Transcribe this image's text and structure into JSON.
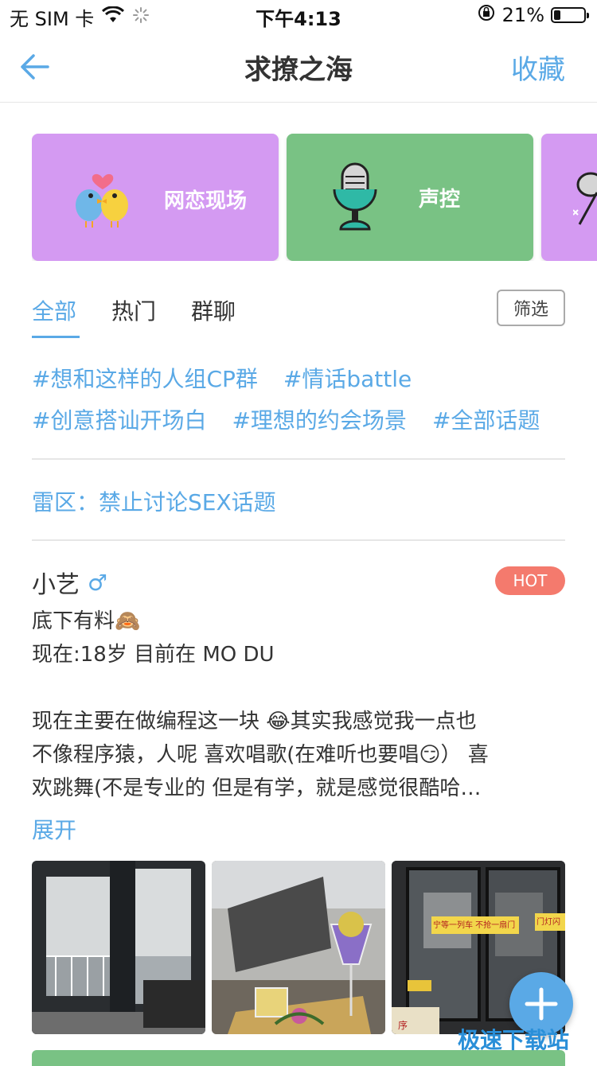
{
  "status_bar": {
    "carrier": "无 SIM 卡",
    "time": "下午4:13",
    "battery": "21%",
    "battery_level": 0.21
  },
  "nav": {
    "title": "求撩之海",
    "favorite_label": "收藏"
  },
  "categories": [
    {
      "label": "网恋现场",
      "color": "#d49af2",
      "icon": "lovebirds-icon"
    },
    {
      "label": "声控",
      "color": "#79c284",
      "icon": "microphone-icon"
    },
    {
      "label": "",
      "color": "#d49af2",
      "icon": "partial-icon"
    }
  ],
  "tabs": {
    "items": [
      "全部",
      "热门",
      "群聊"
    ],
    "active": "全部",
    "filter_label": "筛选"
  },
  "topics": {
    "row1": [
      "#想和这样的人组CP群",
      "#情话battle"
    ],
    "row2": [
      "#创意搭讪开场白",
      "#理想的约会场景",
      "#全部话题"
    ]
  },
  "notice": "雷区：禁止讨论SEX话题",
  "post": {
    "username": "小艺",
    "gender_symbol": "♂",
    "badge": "HOT",
    "line1": "底下有料🙈",
    "line2": "现在:18岁   目前在 MO DU",
    "body1": "现在主要在做编程这一块 😂其实我感觉我一点也",
    "body2": "不像程序猿，人呢 喜欢唱歌(在难听也要唱😏） 喜",
    "body3": "欢跳舞(不是专业的 但是有学，就是感觉很酷哈…",
    "expand_label": "展开",
    "photo_texts": {
      "sign1": "宁等一列车 不抢一扇门",
      "sign2": "门灯闪",
      "sign3": "序"
    }
  },
  "watermark": "极速下载站",
  "colors": {
    "accent": "#5aa9e6",
    "hot": "#f47a6d",
    "purple": "#d49af2",
    "green": "#79c284"
  }
}
